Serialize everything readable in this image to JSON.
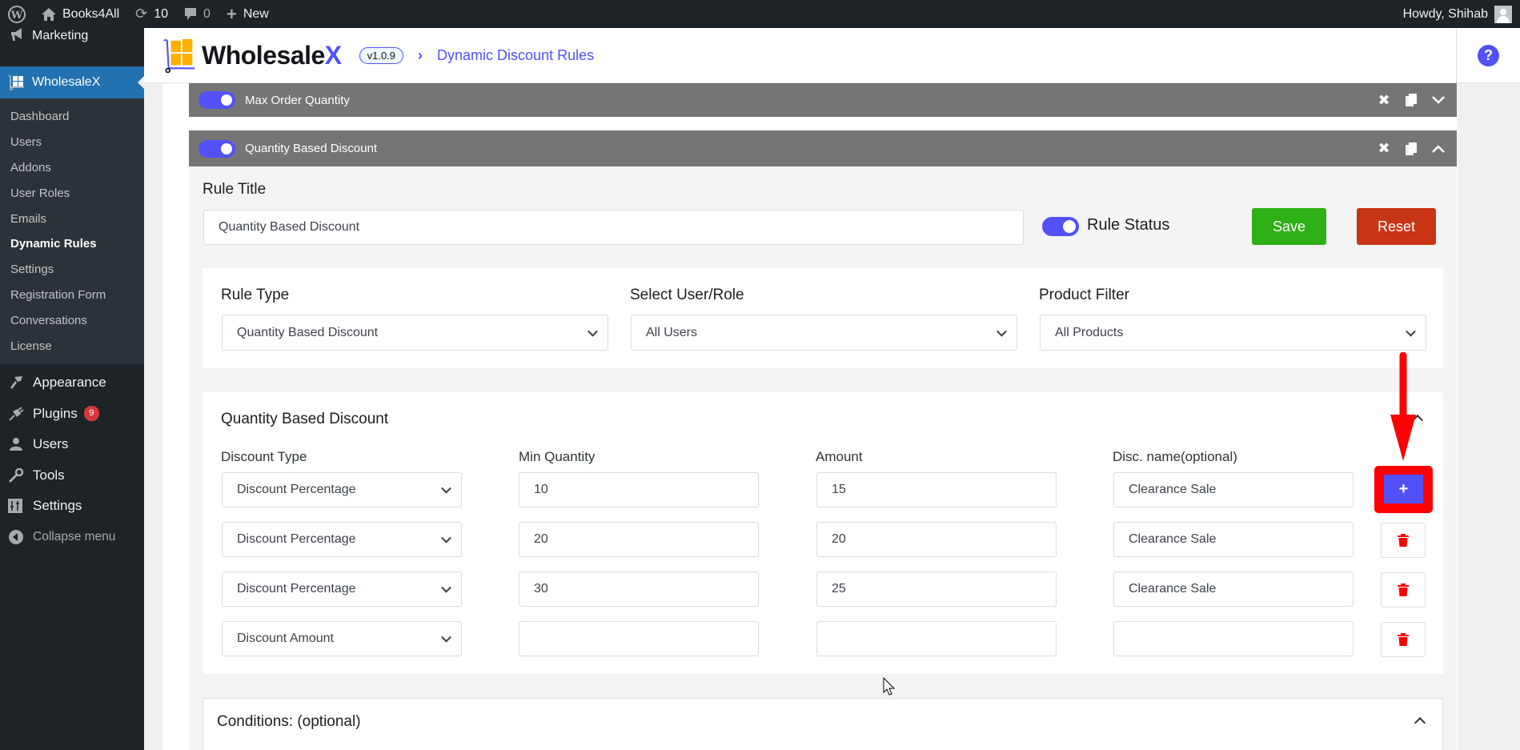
{
  "adminbar": {
    "site_name": "Books4All",
    "updates_count": "10",
    "comments_count": "0",
    "new_label": "New",
    "greeting": "Howdy, Shihab"
  },
  "sidebar": {
    "top_item": "Marketing",
    "active_item": "WholesaleX",
    "submenu": [
      "Dashboard",
      "Users",
      "Addons",
      "User Roles",
      "Emails",
      "Dynamic Rules",
      "Settings",
      "Registration Form",
      "Conversations",
      "License"
    ],
    "current_submenu": "Dynamic Rules",
    "items": [
      {
        "label": "Appearance",
        "icon": "paintbrush-icon"
      },
      {
        "label": "Plugins",
        "icon": "plugin-icon",
        "badge": "9"
      },
      {
        "label": "Users",
        "icon": "user-icon"
      },
      {
        "label": "Tools",
        "icon": "wrench-icon"
      },
      {
        "label": "Settings",
        "icon": "sliders-icon"
      }
    ],
    "collapse_label": "Collapse menu"
  },
  "header": {
    "brand": "Wholesale",
    "brand_x": "X",
    "version": "v1.0.9",
    "breadcrumb": "Dynamic Discount Rules",
    "help_label": "?"
  },
  "rules": [
    {
      "title": "Max Order Quantity",
      "enabled": true,
      "expanded": false
    },
    {
      "title": "Quantity Based Discount",
      "enabled": true,
      "expanded": true
    }
  ],
  "editor": {
    "rule_title_label": "Rule Title",
    "rule_title_value": "Quantity Based Discount",
    "rule_status_label": "Rule Status",
    "rule_status_on": true,
    "save_label": "Save",
    "reset_label": "Reset",
    "rule_type_label": "Rule Type",
    "rule_type_value": "Quantity Based Discount",
    "user_role_label": "Select User/Role",
    "user_role_value": "All Users",
    "product_filter_label": "Product Filter",
    "product_filter_value": "All Products"
  },
  "discount_section": {
    "title": "Quantity Based Discount",
    "columns": [
      "Discount Type",
      "Min Quantity",
      "Amount",
      "Disc. name(optional)"
    ],
    "add_label": "+",
    "rows": [
      {
        "type": "Discount Percentage",
        "min_qty": "10",
        "amount": "15",
        "name": "Clearance Sale"
      },
      {
        "type": "Discount Percentage",
        "min_qty": "20",
        "amount": "20",
        "name": "Clearance Sale"
      },
      {
        "type": "Discount Percentage",
        "min_qty": "30",
        "amount": "25",
        "name": "Clearance Sale"
      },
      {
        "type": "Discount Amount",
        "min_qty": "",
        "amount": "",
        "name": ""
      }
    ]
  },
  "conditions": {
    "title": "Conditions: (optional)"
  },
  "colors": {
    "accent": "#5151f7",
    "save": "#2eaf15",
    "reset": "#c83516",
    "delete": "#ff0000",
    "annotation": "#ff0000"
  }
}
